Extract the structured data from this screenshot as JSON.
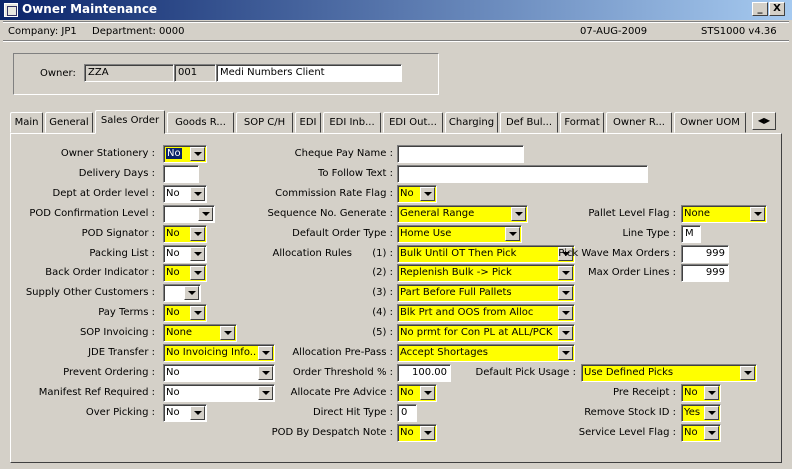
{
  "window": {
    "title": "Owner Maintenance",
    "minimize": "_",
    "close": "X"
  },
  "info": {
    "company": "Company:  JP1",
    "department": "Department:  0000",
    "date": "07-AUG-2009",
    "version": "STS1000  v4.36"
  },
  "owner": {
    "label": "Owner:",
    "code": "ZZA",
    "num": "001",
    "name": "Medi Numbers Client"
  },
  "tabs": [
    "Main",
    "General",
    "Sales Order",
    "Goods R...",
    "SOP C/H",
    "EDI",
    "EDI Inb...",
    "EDI Out...",
    "Charging",
    "Def Bul...",
    "Format",
    "Owner R...",
    "Owner UOM"
  ],
  "active_tab": "Sales Order",
  "colors": {
    "titlebar": "#0a246a",
    "highlight_field": "#ffff00",
    "face": "#d4d0c8"
  },
  "left": [
    {
      "label": "Owner Stationery :",
      "value": "No",
      "type": "select",
      "yellow": true,
      "highlighted": true
    },
    {
      "label": "Delivery Days :",
      "value": "",
      "type": "text"
    },
    {
      "label": "Dept at Order level :",
      "value": "No",
      "type": "select"
    },
    {
      "label": "POD Confirmation Level :",
      "value": "",
      "type": "select"
    },
    {
      "label": "POD Signator :",
      "value": "No",
      "type": "select",
      "yellow": true
    },
    {
      "label": "Packing List :",
      "value": "No",
      "type": "select"
    },
    {
      "label": "Back Order Indicator :",
      "value": "No",
      "type": "select",
      "yellow": true
    },
    {
      "label": "Supply Other Customers :",
      "value": "",
      "type": "select"
    },
    {
      "label": "Pay Terms :",
      "value": "No",
      "type": "select",
      "yellow": true
    },
    {
      "label": "SOP Invoicing :",
      "value": "None",
      "type": "select",
      "yellow": true
    },
    {
      "label": "JDE Transfer :",
      "value": "No Invoicing Info...",
      "type": "select",
      "yellow": true
    },
    {
      "label": "Prevent Ordering :",
      "value": "No",
      "type": "select"
    },
    {
      "label": "Manifest Ref Required :",
      "value": "No",
      "type": "select"
    },
    {
      "label": "Over Picking :",
      "value": "No",
      "type": "select"
    }
  ],
  "middle": [
    {
      "label": "Cheque Pay Name :",
      "value": "",
      "type": "text"
    },
    {
      "label": "To Follow Text :",
      "value": "",
      "type": "text"
    },
    {
      "label": "Commission Rate Flag :",
      "value": "No",
      "type": "select",
      "yellow": true
    },
    {
      "label": "Sequence No. Generate :",
      "value": "General Range",
      "type": "select",
      "yellow": true
    },
    {
      "label": "Default Order Type :",
      "value": "Home Use",
      "type": "select",
      "yellow": true
    },
    {
      "label": "Allocation Rules",
      "value": "Bulk Until OT Then Pick",
      "type": "select",
      "yellow": true,
      "index": "(1) :"
    },
    {
      "label": "",
      "value": "Replenish Bulk -> Pick",
      "type": "select",
      "yellow": true,
      "index": "(2) :"
    },
    {
      "label": "",
      "value": "Part Before Full Pallets",
      "type": "select",
      "yellow": true,
      "index": "(3) :"
    },
    {
      "label": "",
      "value": "Blk Prt and OOS from Alloc",
      "type": "select",
      "yellow": true,
      "index": "(4) :"
    },
    {
      "label": "",
      "value": "No prmt for Con PL at ALL/PCK",
      "type": "select",
      "yellow": true,
      "index": "(5) :"
    },
    {
      "label": "Allocation Pre-Pass :",
      "value": "Accept Shortages",
      "type": "select",
      "yellow": true
    },
    {
      "label": "Order Threshold % :",
      "value": "100.00",
      "type": "text",
      "right": true
    },
    {
      "label": "Allocate  Pre Advice :",
      "value": "No",
      "type": "select",
      "yellow": true
    },
    {
      "label": "Direct Hit Type :",
      "value": "0",
      "type": "text"
    },
    {
      "label": "POD By Despatch Note :",
      "value": "No",
      "type": "select",
      "yellow": true
    }
  ],
  "right": [
    {
      "label": "Pallet Level Flag :",
      "value": "None",
      "type": "select",
      "yellow": true
    },
    {
      "label": "Line Type :",
      "value": "M",
      "type": "text"
    },
    {
      "label": "Pick Wave Max Orders :",
      "value": "999",
      "type": "text",
      "right": true
    },
    {
      "label": "Max Order Lines :",
      "value": "999",
      "type": "text",
      "right": true
    },
    {
      "label": "Default Pick Usage :",
      "value": "Use Defined Picks",
      "type": "select",
      "yellow": true
    },
    {
      "label": "Pre Receipt :",
      "value": "No",
      "type": "select",
      "yellow": true
    },
    {
      "label": "Remove Stock ID :",
      "value": "Yes",
      "type": "select",
      "yellow": true
    },
    {
      "label": "Service Level Flag :",
      "value": "No",
      "type": "select",
      "yellow": true
    }
  ]
}
